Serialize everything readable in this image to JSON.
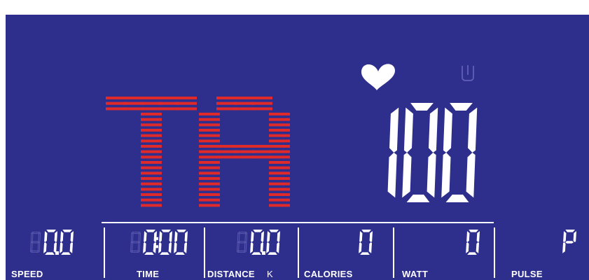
{
  "colors": {
    "background": "#2e2e8c",
    "segment_on": "#ffffff",
    "segment_off": "#5a5ab0",
    "matrix": "#e02a2a"
  },
  "icons": {
    "heart": "heart-icon",
    "unit": "u-unit-icon"
  },
  "matrix_display": {
    "text": "TA"
  },
  "main_display": {
    "value": "100"
  },
  "readouts": {
    "speed": {
      "value": "0.0",
      "label": "SPEED"
    },
    "time": {
      "value": "0:00",
      "label": "TIME"
    },
    "distance": {
      "value": "0.0",
      "label": "DISTANCE",
      "unit": "K"
    },
    "calories": {
      "value": "0",
      "label": "CALORIES"
    },
    "watt": {
      "value": "0",
      "label": "WATT"
    },
    "pulse": {
      "value": "P",
      "label": "PULSE"
    }
  }
}
